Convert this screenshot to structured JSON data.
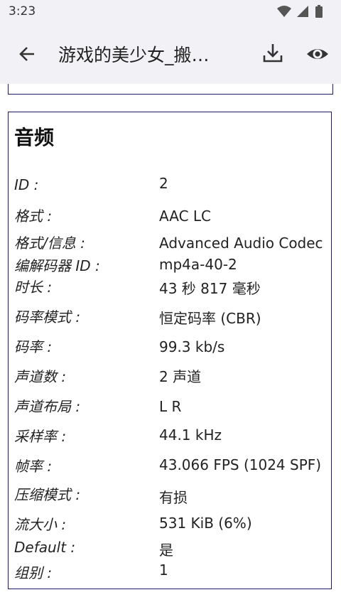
{
  "status_bar": {
    "time": "3:23",
    "icons": [
      "wifi-icon",
      "cell-signal-icon",
      "battery-icon"
    ]
  },
  "app_bar": {
    "title": "游戏的美少女_搬…",
    "icons": [
      "back-arrow-icon",
      "download-icon",
      "eye-icon"
    ]
  },
  "audio_section": {
    "heading": "音频",
    "rows": [
      {
        "label": "ID :",
        "value": "2"
      },
      {
        "label": "格式 :",
        "value": "AAC LC"
      },
      {
        "label": "格式/信息 :",
        "value": "Advanced Audio Codec"
      },
      {
        "label": "编解码器 ID :",
        "value": "mp4a-40-2"
      },
      {
        "label": "时长 :",
        "value": "43 秒 817 毫秒"
      },
      {
        "label": "码率模式 :",
        "value": "恒定码率 (CBR)"
      },
      {
        "label": "码率 :",
        "value": "99.3 kb/s"
      },
      {
        "label": "声道数 :",
        "value": "2 声道"
      },
      {
        "label": "声道布局 :",
        "value": "L R"
      },
      {
        "label": "采样率 :",
        "value": "44.1 kHz"
      },
      {
        "label": "帧率 :",
        "value": "43.066 FPS (1024 SPF)"
      },
      {
        "label": "压缩模式 :",
        "value": "有损"
      },
      {
        "label": "流大小 :",
        "value": "531 KiB (6%)"
      },
      {
        "label": "Default :",
        "value": "是"
      },
      {
        "label": "组别 :",
        "value": "1"
      }
    ]
  }
}
